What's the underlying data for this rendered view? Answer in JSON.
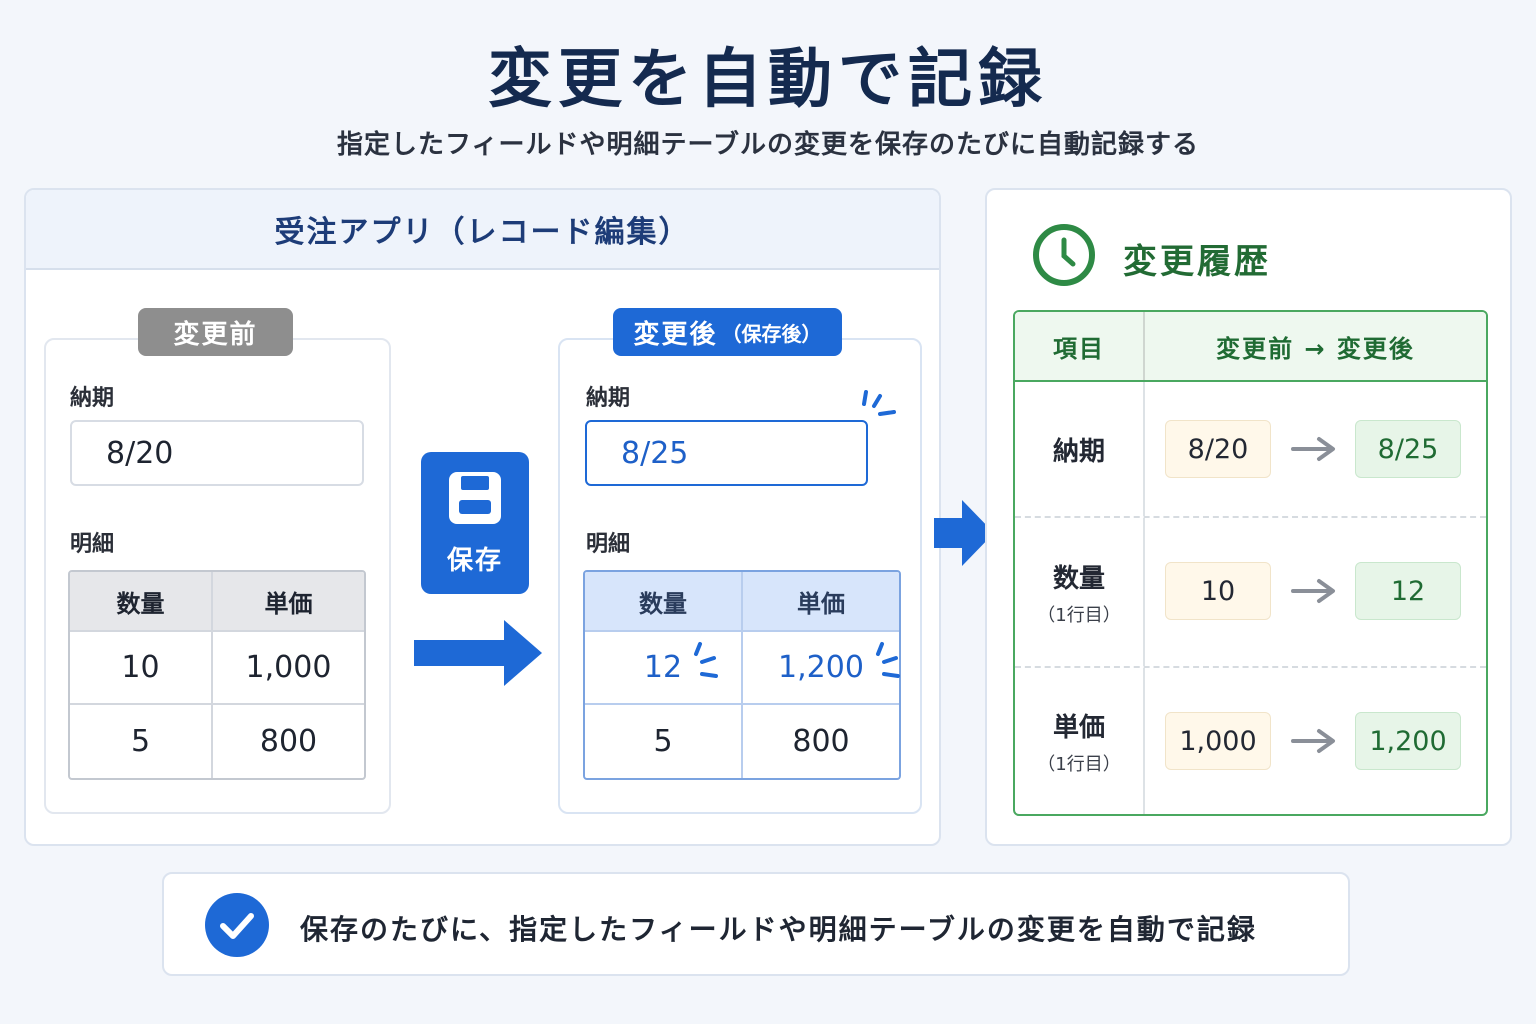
{
  "title": "変更を自動で記録",
  "subtitle": "指定したフィールドや明細テーブルの変更を保存のたびに自動記録する",
  "app": {
    "header": "受注アプリ（レコード編集）",
    "before": {
      "badge": "変更前",
      "due_label": "納期",
      "due_value": "8/20",
      "detail_label": "明細",
      "columns": [
        "数量",
        "単価"
      ],
      "rows": [
        [
          "10",
          "1,000"
        ],
        [
          "5",
          "800"
        ]
      ]
    },
    "after": {
      "badge": "変更後",
      "badge_sub": "（保存後）",
      "due_label": "納期",
      "due_value": "8/25",
      "detail_label": "明細",
      "columns": [
        "数量",
        "単価"
      ],
      "rows": [
        [
          "12",
          "1,200"
        ],
        [
          "5",
          "800"
        ]
      ]
    },
    "save_button": "保存"
  },
  "history": {
    "title": "変更履歴",
    "col_item": "項目",
    "col_change": "変更前 → 変更後",
    "rows": [
      {
        "item": "納期",
        "sub": "",
        "old": "8/20",
        "new": "8/25"
      },
      {
        "item": "数量",
        "sub": "（1行目）",
        "old": "10",
        "new": "12"
      },
      {
        "item": "単価",
        "sub": "（1行目）",
        "old": "1,000",
        "new": "1,200"
      }
    ]
  },
  "footer": "保存のたびに、指定したフィールドや明細テーブルの変更を自動で記録",
  "colors": {
    "primary": "#1e69d6",
    "history_green": "#226b34",
    "title_navy": "#142a4f"
  }
}
